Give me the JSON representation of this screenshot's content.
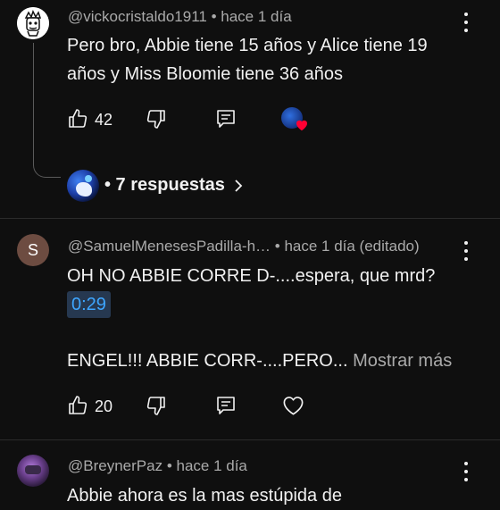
{
  "comments": [
    {
      "author": "@vickocristaldo1911",
      "meta": "• hace 1 día",
      "text_line1": "Pero bro, Abbie tiene 15 años y Alice tiene 19",
      "text_line2": "años y Miss Bloomie tiene 36 años",
      "likes": "42",
      "replies_label": "• 7 respuestas"
    },
    {
      "author": "@SamuelMenesesPadilla-h…",
      "meta": "• hace 1 día (editado)",
      "avatar_letter": "S",
      "text_line1": "OH NO ABBIE CORRE D-....espera, que mrd?",
      "timestamp": "0:29",
      "text_line3": "ENGEL!!! ABBIE CORR-....PERO...",
      "more_label": "Mostrar más",
      "likes": "20"
    },
    {
      "author": "@BreynerPaz",
      "meta": "• hace 1 día",
      "text_partial": "Abbie ahora es la mas estúpida de"
    }
  ],
  "colors": {
    "background": "#0f0f0f",
    "link": "#3ea6ff",
    "avatar_s": "#6d4c41",
    "heart": "#ff0033"
  }
}
